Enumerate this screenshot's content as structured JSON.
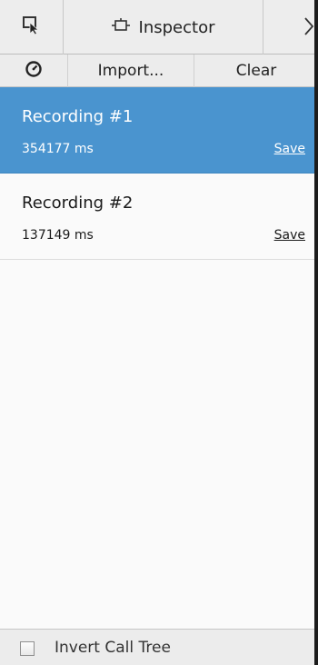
{
  "tabs": {
    "picker_icon": "element-picker-icon",
    "inspector": {
      "label": "Inspector",
      "icon": "inspector-icon"
    },
    "next_icon": "debugger-icon"
  },
  "toolbar": {
    "stopwatch_icon": "stopwatch-icon",
    "import_label": "Import...",
    "clear_label": "Clear"
  },
  "recordings": [
    {
      "title": "Recording #1",
      "duration": "354177 ms",
      "save_label": "Save",
      "selected": true
    },
    {
      "title": "Recording #2",
      "duration": "137149 ms",
      "save_label": "Save",
      "selected": false
    }
  ],
  "footer": {
    "invert_call_tree_label": "Invert Call Tree",
    "invert_call_tree_checked": false
  },
  "colors": {
    "selected_row": "#4a94cf",
    "toolbar_bg": "#ececec",
    "list_bg": "#fafafa"
  }
}
